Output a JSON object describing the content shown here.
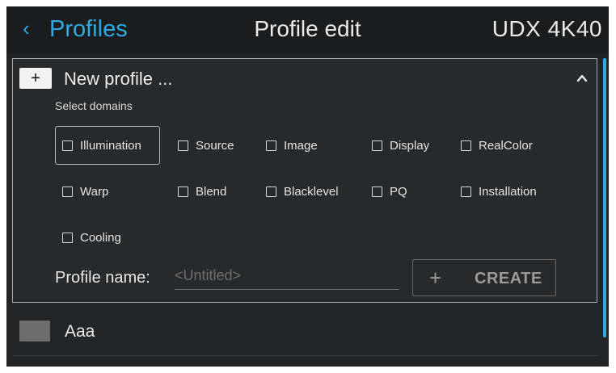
{
  "header": {
    "back_chevron": "‹",
    "back_label": "Profiles",
    "title": "Profile edit",
    "device": "UDX 4K40"
  },
  "new_profile": {
    "plus": "+",
    "title": "New profile ...",
    "select_domains_label": "Select domains",
    "domains": [
      {
        "label": "Illumination",
        "checked": false
      },
      {
        "label": "Source",
        "checked": false
      },
      {
        "label": "Image",
        "checked": false
      },
      {
        "label": "Display",
        "checked": false
      },
      {
        "label": "RealColor",
        "checked": false
      },
      {
        "label": "Warp",
        "checked": false
      },
      {
        "label": "Blend",
        "checked": false
      },
      {
        "label": "Blacklevel",
        "checked": false
      },
      {
        "label": "PQ",
        "checked": false
      },
      {
        "label": "Installation",
        "checked": false
      },
      {
        "label": "Cooling",
        "checked": false
      }
    ],
    "profile_name_label": "Profile name:",
    "profile_name_placeholder": "<Untitled>",
    "profile_name_value": "",
    "create_plus": "+",
    "create_label": "CREATE"
  },
  "profiles": [
    {
      "label": "Aaa"
    }
  ],
  "colors": {
    "accent": "#2fa9e2",
    "background": "#222426",
    "swatch": "#6d6d6d"
  }
}
